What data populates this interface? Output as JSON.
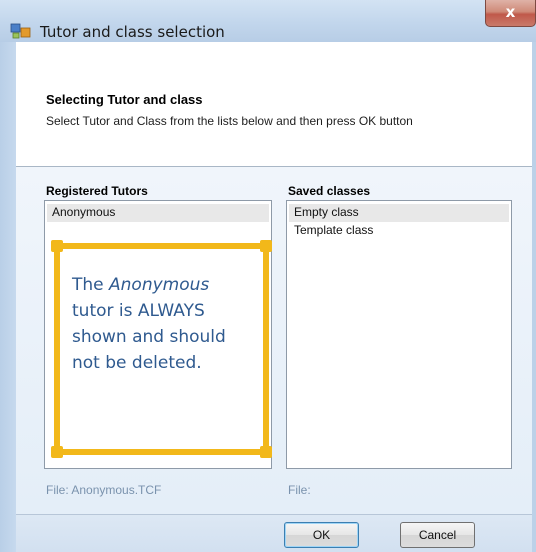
{
  "window": {
    "title": "Tutor and class selection",
    "close_glyph": "x"
  },
  "header": {
    "title": "Selecting Tutor and class",
    "description": "Select Tutor and Class from the lists below and then press OK button"
  },
  "tutors": {
    "label": "Registered Tutors",
    "items": [
      "Anonymous"
    ],
    "file_label": "File:  Anonymous.TCF"
  },
  "classes": {
    "label": "Saved classes",
    "items": [
      "Empty class",
      "Template class"
    ],
    "file_label": "File:"
  },
  "annotation": {
    "prefix": "The ",
    "emphasis": "Anonymous",
    "suffix": " tutor is ALWAYS shown and should not be deleted.",
    "color": "#f2b81a"
  },
  "buttons": {
    "ok": "OK",
    "cancel": "Cancel"
  },
  "icons": {
    "title": "app-icon",
    "close": "close-icon"
  }
}
